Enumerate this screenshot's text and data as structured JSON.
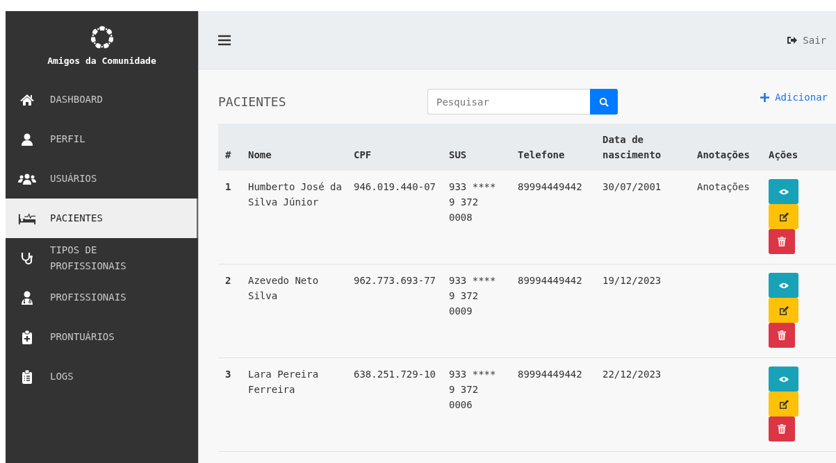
{
  "sidebar": {
    "brand": "Amigos da Comunidade",
    "items": [
      {
        "label": "DASHBOARD",
        "kind": "home",
        "selected": false
      },
      {
        "label": "PERFIL",
        "kind": "user",
        "selected": false
      },
      {
        "label": "USUÁRIOS",
        "kind": "users",
        "selected": false
      },
      {
        "label": "PACIENTES",
        "kind": "bed",
        "selected": true
      },
      {
        "label": "TIPOS DE PROFISSIONAIS",
        "kind": "stethoscope",
        "selected": false
      },
      {
        "label": "PROFISSIONAIS",
        "kind": "doctor",
        "selected": false
      },
      {
        "label": "PRONTUÁRIOS",
        "kind": "clipboard-plus",
        "selected": false
      },
      {
        "label": "LOGS",
        "kind": "clipboard-list",
        "selected": false
      }
    ]
  },
  "header": {
    "logout": "Sair"
  },
  "page": {
    "title": "PACIENTES",
    "search": {
      "placeholder": "Pesquisar"
    },
    "add": "Adicionar"
  },
  "table": {
    "columns": [
      "#",
      "Nome",
      "CPF",
      "SUS",
      "Telefone",
      "Data de nascimento",
      "Anotações",
      "Ações"
    ],
    "rows": [
      {
        "id": "1",
        "name": "Humberto José da Silva Júnior",
        "cpf": "946.019.440-07",
        "sus": "933 **** 9 372 0008",
        "phone": "89994449442",
        "birth": "30/07/2001",
        "notes": "Anotações"
      },
      {
        "id": "2",
        "name": "Azevedo Neto Silva",
        "cpf": "962.773.693-77",
        "sus": "933 **** 9 372 0009",
        "phone": "89994449442",
        "birth": "19/12/2023"
      },
      {
        "id": "3",
        "name": "Lara Pereira Ferreira",
        "cpf": "638.251.729-10",
        "sus": "933 **** 9 372 0006",
        "phone": "89994449442",
        "birth": "22/12/2023"
      }
    ]
  }
}
